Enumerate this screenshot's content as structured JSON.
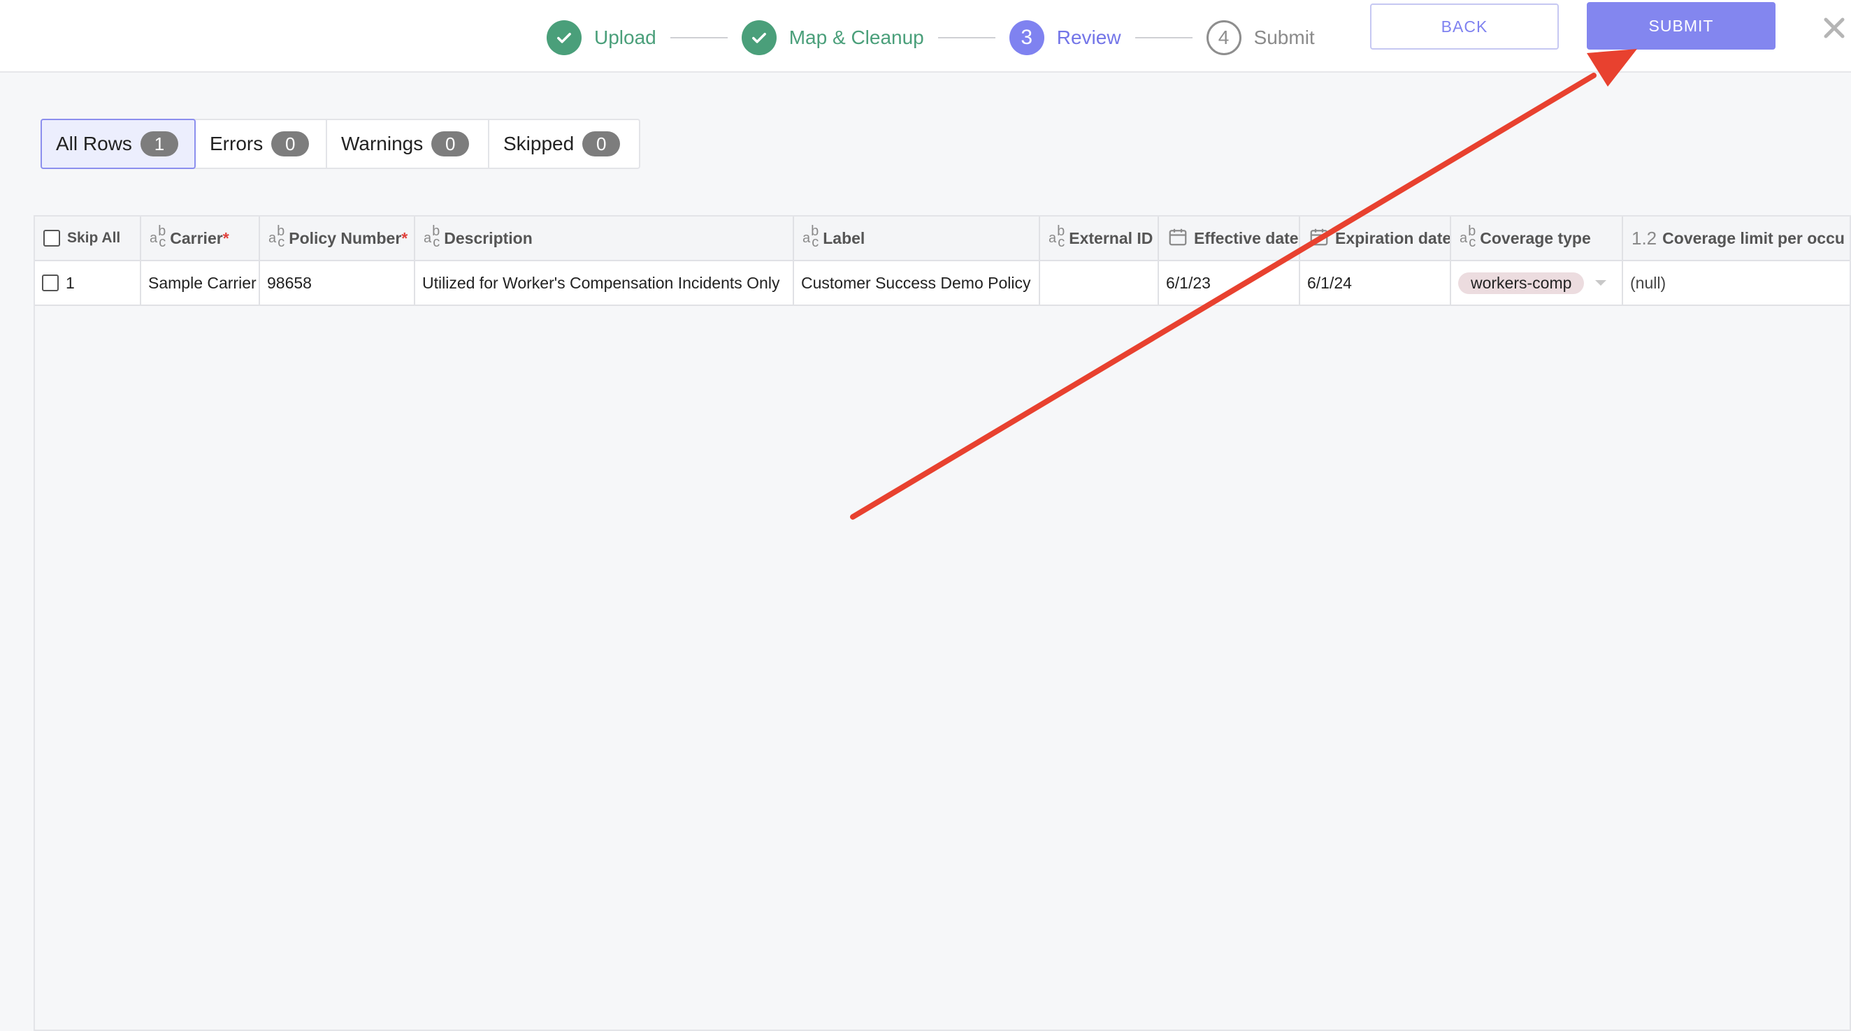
{
  "steps": [
    {
      "number": "",
      "label": "Upload",
      "state": "done"
    },
    {
      "number": "",
      "label": "Map & Cleanup",
      "state": "done"
    },
    {
      "number": "3",
      "label": "Review",
      "state": "active"
    },
    {
      "number": "4",
      "label": "Submit",
      "state": "todo"
    }
  ],
  "header": {
    "back_label": "BACK",
    "submit_label": "SUBMIT"
  },
  "filters": [
    {
      "label": "All Rows",
      "count": "1"
    },
    {
      "label": "Errors",
      "count": "0"
    },
    {
      "label": "Warnings",
      "count": "0"
    },
    {
      "label": "Skipped",
      "count": "0"
    }
  ],
  "table": {
    "skip_all_label": "Skip All",
    "columns": [
      {
        "label": "Carrier",
        "required": "*",
        "type_icon": "text-type-icon"
      },
      {
        "label": "Policy Number",
        "required": "*",
        "type_icon": "text-type-icon"
      },
      {
        "label": "Description",
        "required": "",
        "type_icon": "text-type-icon"
      },
      {
        "label": "Label",
        "required": "",
        "type_icon": "text-type-icon"
      },
      {
        "label": "External ID",
        "required": "",
        "type_icon": "text-type-icon"
      },
      {
        "label": "Effective date",
        "required": "",
        "type_icon": "calendar-icon"
      },
      {
        "label": "Expiration date",
        "required": "",
        "type_icon": "calendar-icon"
      },
      {
        "label": "Coverage type",
        "required": "",
        "type_icon": "text-type-icon"
      },
      {
        "label": "Coverage limit per occu",
        "required": "",
        "type_icon": "number-type-icon",
        "type_text": "1.2"
      }
    ],
    "rows": [
      {
        "row_number": "1",
        "carrier": "Sample Carrier",
        "policy_number": "98658",
        "description": "Utilized for Worker's Compensation Incidents Only",
        "label": "Customer Success Demo Policy",
        "external_id": "",
        "effective_date": "6/1/23",
        "expiration_date": "6/1/24",
        "coverage_type": "workers-comp",
        "coverage_limit": "(null)"
      }
    ]
  },
  "colors": {
    "accent": "#8386ef",
    "done_green": "#4a9f7a",
    "annotation_red": "#e8412f"
  }
}
